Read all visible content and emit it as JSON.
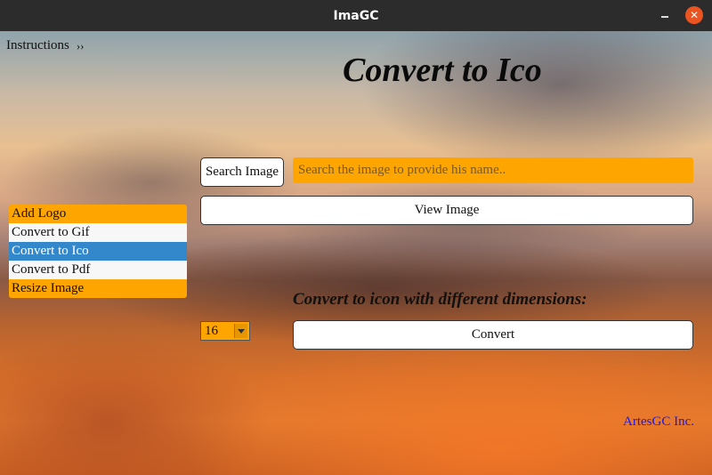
{
  "window": {
    "title": "ImaGC",
    "close_glyph": "✕"
  },
  "instructions": {
    "label": "Instructions",
    "chevron": "››"
  },
  "heading": "Convert to Ico",
  "search": {
    "button_label": "Search Image",
    "placeholder": "Search the image to provide his name.."
  },
  "view_button_label": "View Image",
  "menu": {
    "items": [
      {
        "label": "Add Logo",
        "style": "orange"
      },
      {
        "label": "Convert to Gif",
        "style": "light"
      },
      {
        "label": "Convert to Ico",
        "style": "selected"
      },
      {
        "label": "Convert to Pdf",
        "style": "light"
      },
      {
        "label": "Resize Image",
        "style": "orange"
      }
    ]
  },
  "subheading": "Convert to icon with different dimensions:",
  "dimension_select": {
    "value": "16"
  },
  "convert_button_label": "Convert",
  "footer": "ArtesGC Inc.",
  "colors": {
    "accent": "#ffa500",
    "selected": "#3388cc",
    "link": "#1a1ae0",
    "close": "#e95420"
  }
}
